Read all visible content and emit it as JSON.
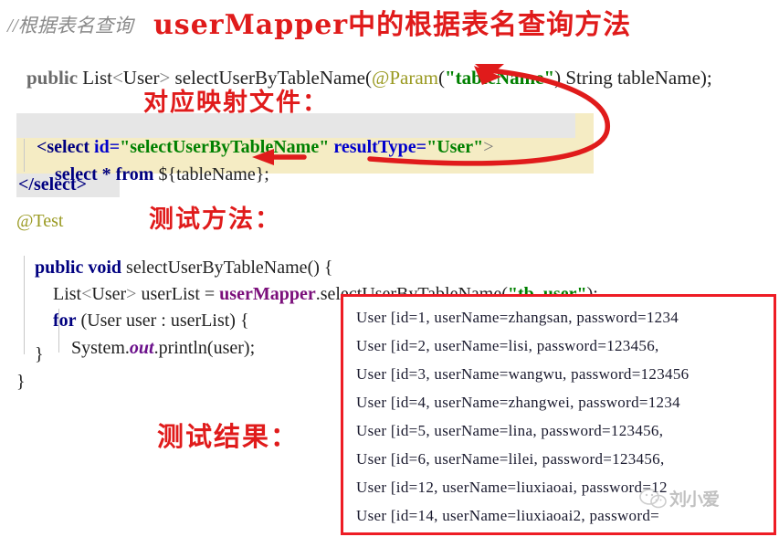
{
  "title_line": {
    "comment": "//根据表名查询",
    "heading": "userMapper中的根据表名查询方法"
  },
  "java_interface": {
    "kw_public": "public",
    "type": " List",
    "lt": "<",
    "generic": "User",
    "gt": ">",
    "method": " selectUserByTableName(",
    "annotation": "@Param",
    "open_paren": "(",
    "param_string": "\"tableName\"",
    "close": ") String tableName);"
  },
  "annotations": {
    "mapper_file": "对应映射文件：",
    "test_method": "测试方法：",
    "test_result": "测试结果："
  },
  "mapper_xml": {
    "line1_open": "<select ",
    "line1_attr1": "id=",
    "line1_val1": "\"selectUserByTableName\"",
    "line1_attr2": " resultType=",
    "line1_val2": "\"User\"",
    "line1_close": ">",
    "line2_indent": "    ",
    "line2_kw": "select * from ",
    "line2_expr": "${tableName};",
    "line3": "</select>"
  },
  "test_code": {
    "l1_anno": "@Test",
    "l2_kw": "public void",
    "l2_rest": " selectUserByTableName() {",
    "l3_indent": "    ",
    "l3_a": "List",
    "l3_lt": "<",
    "l3_gen": "User",
    "l3_gt": ">",
    "l3_b": " userList = ",
    "l3_mapper": "userMapper",
    "l3_c": ".selectUserByTableName(",
    "l3_str": "\"tb_user\"",
    "l3_d": ");",
    "l4_indent": "    ",
    "l4_kw": "for",
    "l4_rest": " (User user : userList) {",
    "l5_indent": "        ",
    "l5_a": "System.",
    "l5_out": "out",
    "l5_b": ".println(user);",
    "l6": "    }",
    "l7": "}"
  },
  "console": {
    "lines": [
      "User [id=1, userName=zhangsan, password=1234",
      "User [id=2, userName=lisi, password=123456,",
      "User [id=3, userName=wangwu, password=123456",
      "User [id=4, userName=zhangwei, password=1234",
      "User [id=5, userName=lina, password=123456,",
      "User [id=6, userName=lilei, password=123456,",
      "User [id=12, userName=liuxiaoai, password=12",
      "User [id=14, userName=liuxiaoai2, password="
    ]
  },
  "watermark": {
    "label": "刘小爱",
    "icon": "wechat-icon"
  },
  "colors": {
    "accent_red": "#e01b1b",
    "box_red": "#ee1c25",
    "highlight_yellow": "#f5ecc4",
    "string_green": "#008000",
    "attr_blue": "#0000cc",
    "tag_navy": "#000080",
    "mapper_purple": "#7b0f7b",
    "annotation_olive": "#9a9a22"
  }
}
